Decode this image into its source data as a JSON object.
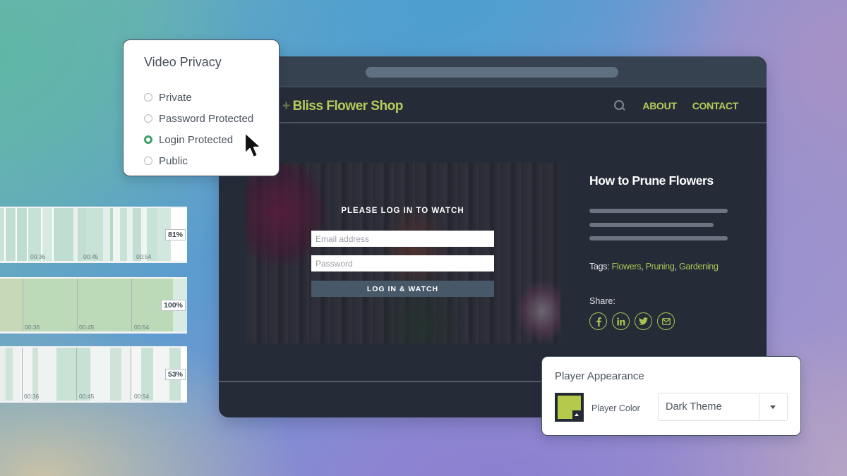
{
  "browser": {
    "site": {
      "logo_plus": "+",
      "logo_text": "Bliss Flower Shop",
      "nav": [
        {
          "label": "ABOUT"
        },
        {
          "label": "CONTACT"
        }
      ],
      "search_icon": "search-icon"
    },
    "video": {
      "login_title": "PLEASE LOG IN TO WATCH",
      "email_placeholder": "Email address",
      "password_placeholder": "Password",
      "login_button": "LOG IN & WATCH"
    },
    "sidebar": {
      "title": "How to Prune Flowers",
      "tags_label": "Tags: ",
      "tags": [
        "Flowers",
        "Pruning",
        "Gardening"
      ],
      "tag_separator": ", ",
      "share_label": "Share:",
      "share_icons": [
        {
          "name": "facebook-icon",
          "glyph": "f"
        },
        {
          "name": "linkedin-icon",
          "glyph": "in"
        },
        {
          "name": "twitter-icon",
          "glyph": "🐦"
        },
        {
          "name": "email-icon",
          "glyph": "✉"
        }
      ]
    }
  },
  "privacy": {
    "title": "Video Privacy",
    "options": [
      {
        "label": "Private",
        "selected": false
      },
      {
        "label": "Password Protected",
        "selected": false
      },
      {
        "label": "Login Protected",
        "selected": true
      },
      {
        "label": "Public",
        "selected": false
      }
    ]
  },
  "heatmaps": [
    {
      "percent": "81%",
      "ticks": [
        "00:36",
        "00:45",
        "00:54"
      ]
    },
    {
      "percent": "100%",
      "ticks": [
        "00:36",
        "00:45",
        "00:54"
      ]
    },
    {
      "percent": "53%",
      "ticks": [
        "00:36",
        "00:45",
        "00:54"
      ]
    }
  ],
  "appearance": {
    "title": "Player Appearance",
    "color_label": "Player Color",
    "player_color": "#b5c94b",
    "theme_selected": "Dark Theme"
  },
  "colors": {
    "accent_green": "#b4cc5a",
    "radio_selected": "#3fa066",
    "browser_bg": "#252c37"
  }
}
